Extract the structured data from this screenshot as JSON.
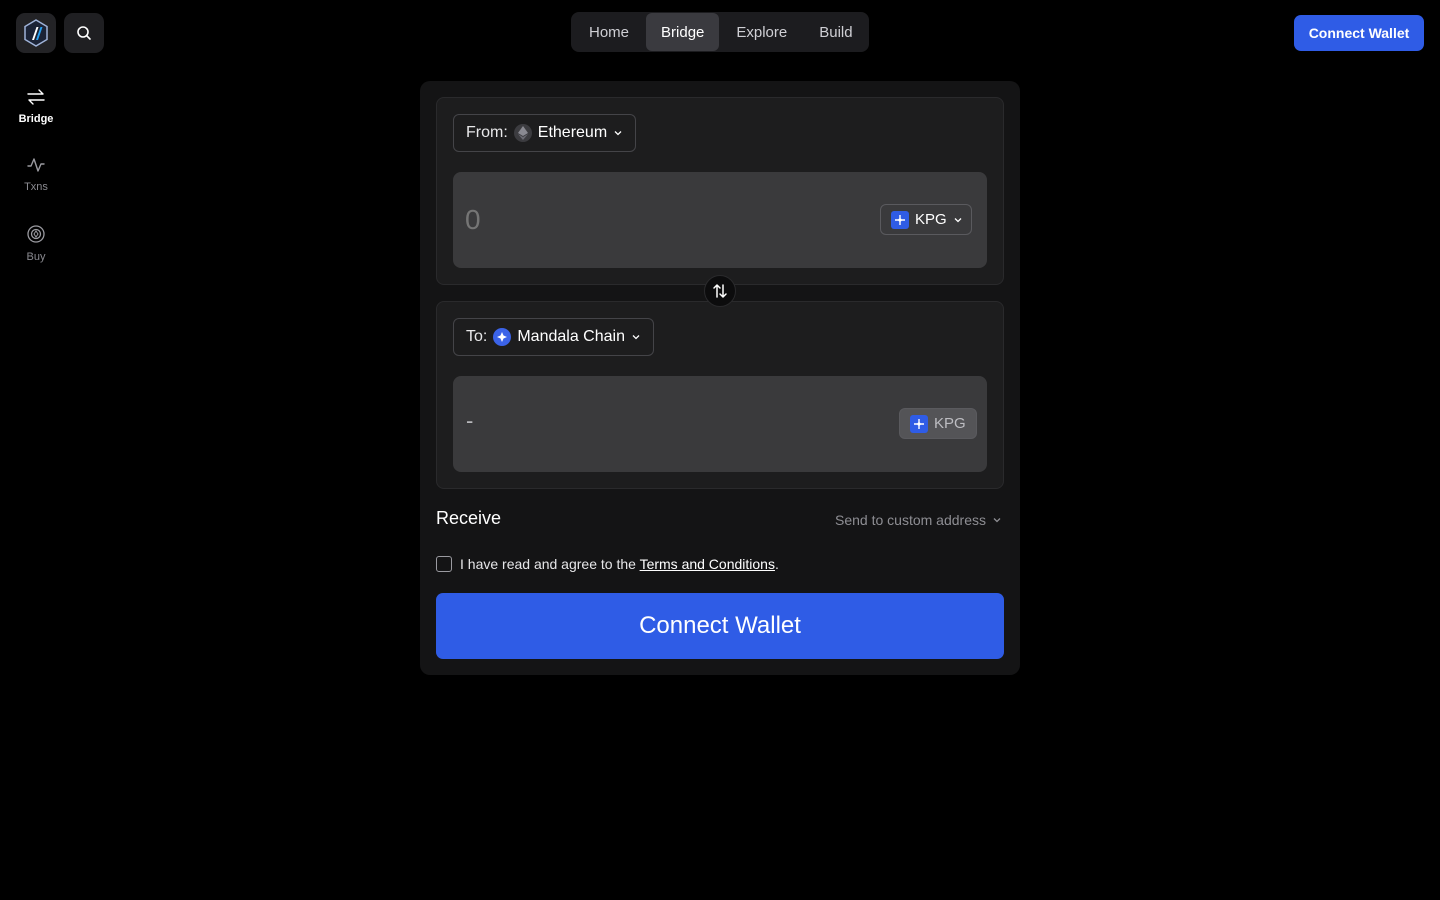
{
  "header": {
    "logo_icon": "arbitrum-logo-icon",
    "search_icon": "search-icon",
    "nav": [
      {
        "label": "Home",
        "active": false
      },
      {
        "label": "Bridge",
        "active": true
      },
      {
        "label": "Explore",
        "active": false
      },
      {
        "label": "Build",
        "active": false
      }
    ],
    "connect_label": "Connect Wallet"
  },
  "sidebar": {
    "items": [
      {
        "label": "Bridge",
        "icon": "arrows-left-right-icon",
        "active": true
      },
      {
        "label": "Txns",
        "icon": "activity-icon",
        "active": false
      },
      {
        "label": "Buy",
        "icon": "target-icon",
        "active": false
      }
    ]
  },
  "bridge": {
    "from": {
      "prefix": "From:",
      "chain": "Ethereum",
      "amount_value": "",
      "amount_placeholder": "0",
      "token": "KPG"
    },
    "to": {
      "prefix": "To:",
      "chain": "Mandala Chain",
      "amount": "-",
      "token": "KPG"
    },
    "receive_label": "Receive",
    "custom_address_label": "Send to custom address",
    "terms_text": "I have read and agree to the",
    "terms_link": "Terms and Conditions",
    "terms_suffix": ".",
    "terms_checked": false,
    "connect_label": "Connect Wallet"
  },
  "colors": {
    "accent": "#2f5ce6",
    "background": "#000000",
    "card": "#141415"
  }
}
